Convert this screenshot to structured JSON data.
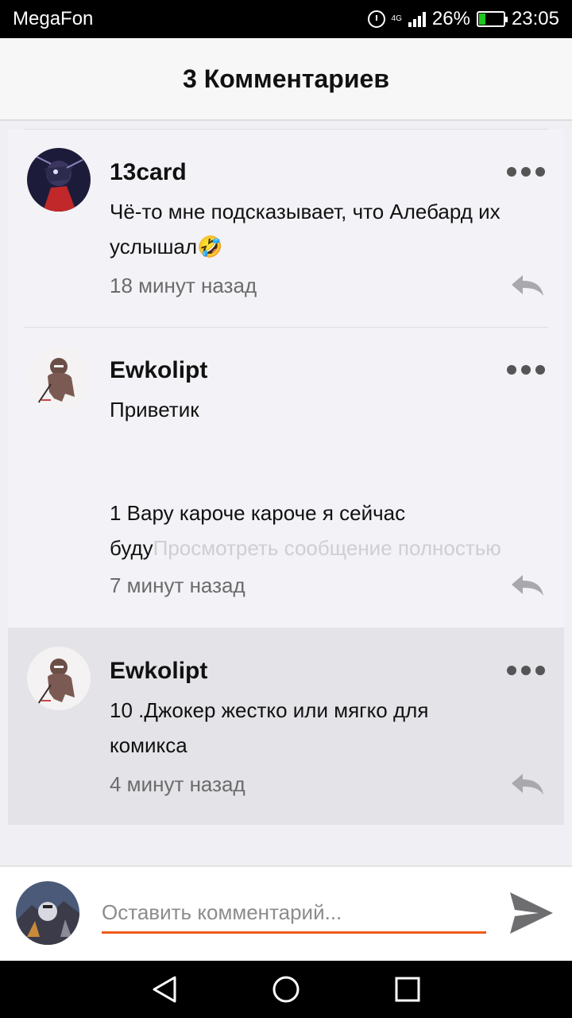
{
  "status_bar": {
    "carrier": "MegaFon",
    "network": "4G",
    "battery_percent": "26%",
    "time": "23:05",
    "battery_level": 0.26,
    "battery_color": "#1ec61e"
  },
  "header": {
    "title": "3 Комментариев"
  },
  "comments": [
    {
      "author": "13card",
      "text_lines": [
        "Чё-то мне подсказывает, что Алебард их",
        "услышал🤣"
      ],
      "time": "18 минут назад",
      "avatar_icon": "avatar-anime-icon",
      "highlighted": false
    },
    {
      "author": "Ewkolipt",
      "text_lines": [
        "Приветик",
        "",
        "",
        "1 Вару кароче кароче я сейчас",
        "буду"
      ],
      "expand_link": "Просмотреть сообщение полностью",
      "time": "7 минут назад",
      "avatar_icon": "avatar-ninja-icon",
      "highlighted": false
    },
    {
      "author": "Ewkolipt",
      "text_lines": [
        "10 .Джокер жестко или мягко для",
        "комикса"
      ],
      "time": "4 минут назад",
      "avatar_icon": "avatar-ninja-icon",
      "highlighted": true
    }
  ],
  "comment_input": {
    "placeholder": "Оставить комментарий...",
    "value": ""
  },
  "colors": {
    "accent": "#f05a1a",
    "highlight_bg": "#e4e3e7"
  }
}
